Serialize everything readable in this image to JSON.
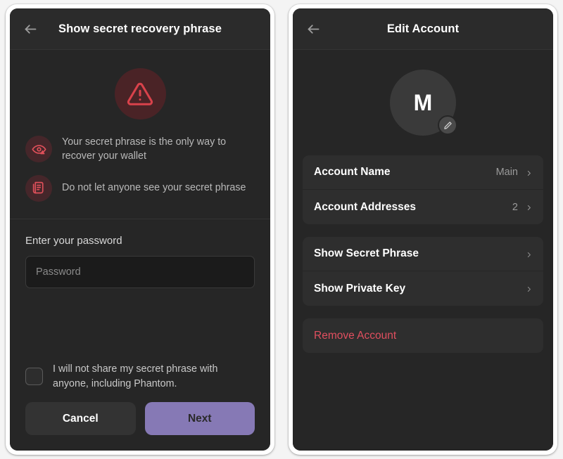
{
  "left_panel": {
    "header": {
      "back_icon": "arrow-left-icon",
      "title": "Show secret recovery phrase"
    },
    "hero_icon": "warning-triangle-icon",
    "warnings": [
      {
        "icon": "eye-warning-icon",
        "text": "Your secret phrase is the only way to recover your wallet"
      },
      {
        "icon": "document-warning-icon",
        "text": "Do not let anyone see your secret phrase"
      }
    ],
    "password": {
      "label": "Enter your password",
      "placeholder": "Password",
      "value": ""
    },
    "agreement": {
      "checked": false,
      "text": "I will not share my secret phrase with anyone, including Phantom."
    },
    "buttons": {
      "cancel_label": "Cancel",
      "next_label": "Next"
    }
  },
  "right_panel": {
    "header": {
      "back_icon": "arrow-left-icon",
      "title": "Edit Account"
    },
    "avatar": {
      "initial": "M",
      "edit_icon": "pencil-icon"
    },
    "groups": [
      {
        "rows": [
          {
            "label": "Account Name",
            "value": "Main",
            "chevron": "chevron-right-icon",
            "danger": false
          },
          {
            "label": "Account Addresses",
            "value": "2",
            "chevron": "chevron-right-icon",
            "danger": false
          }
        ]
      },
      {
        "rows": [
          {
            "label": "Show Secret Phrase",
            "value": "",
            "chevron": "chevron-right-icon",
            "danger": false
          },
          {
            "label": "Show Private Key",
            "value": "",
            "chevron": "chevron-right-icon",
            "danger": false
          }
        ]
      },
      {
        "rows": [
          {
            "label": "Remove Account",
            "value": "",
            "chevron": "",
            "danger": true
          }
        ]
      }
    ]
  },
  "colors": {
    "background": "#262626",
    "surface": "#2e2e2e",
    "header": "#2b2b2b",
    "accent_purple": "#8679b5",
    "danger_red": "#e04f5f",
    "warning_red": "#d9424b",
    "warning_circle": "#45262a"
  }
}
